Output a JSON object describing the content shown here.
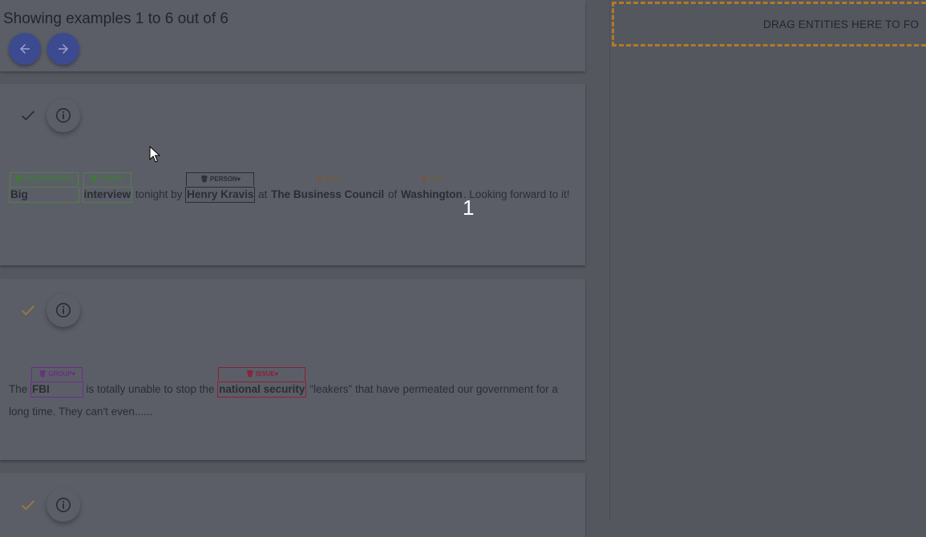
{
  "header": {
    "showing_text": "Showing examples 1 to 6 out of 6",
    "prev_icon": "arrow-left-icon",
    "next_icon": "arrow-right-icon"
  },
  "examples": [
    {
      "check_icon": "check-icon",
      "info_icon": "info-icon",
      "tokens": [
        {
          "text": "Big",
          "tag": "SUBORDINATE",
          "tag_color": "#3f7a3a",
          "boxed": true,
          "border": "#4f7f4c"
        },
        {
          "text": "interview",
          "tag": "EVENT",
          "tag_color": "#3f7a3a",
          "boxed": true,
          "border": "#4f7f4c"
        },
        {
          "text": " tonight by "
        },
        {
          "text": "Henry Kravis",
          "tag": "PERSON",
          "tag_color": "#2b2d35",
          "boxed": true,
          "border": "#2b2d35"
        },
        {
          "text": " at "
        },
        {
          "text": "The Business Council",
          "tag": "ORG",
          "tag_color": "#6b5a44",
          "boxed": false
        },
        {
          "text": " of "
        },
        {
          "text": "Washington",
          "tag": "LOC",
          "tag_color": "#6b5a44",
          "boxed": false
        },
        {
          "text": ". Looking forward to it!"
        }
      ]
    },
    {
      "check_icon": "check-icon",
      "info_icon": "info-icon",
      "tokens": [
        {
          "text": "The "
        },
        {
          "text": "FBI",
          "tag": "GROUP",
          "tag_color": "#6a2d8a",
          "boxed": true,
          "border": "#6a2d8a"
        },
        {
          "text": " is totally unable to stop the "
        },
        {
          "text": "national security",
          "tag": "ISSUE",
          "tag_color": "#8a1f3a",
          "boxed": true,
          "border": "#8a1f3a"
        },
        {
          "text": " \"leakers\" that have permeated our government for a long time. They can't even......"
        }
      ]
    },
    {
      "check_icon": "check-icon",
      "info_icon": "info-icon"
    }
  ],
  "drop_zone": {
    "label": "DRAG ENTITIES HERE TO FO"
  },
  "overlay_number": "1",
  "colors": {
    "accent": "#3c4a8f",
    "drop_border": "#b07a2a",
    "check_done": "#9a7a3a"
  }
}
